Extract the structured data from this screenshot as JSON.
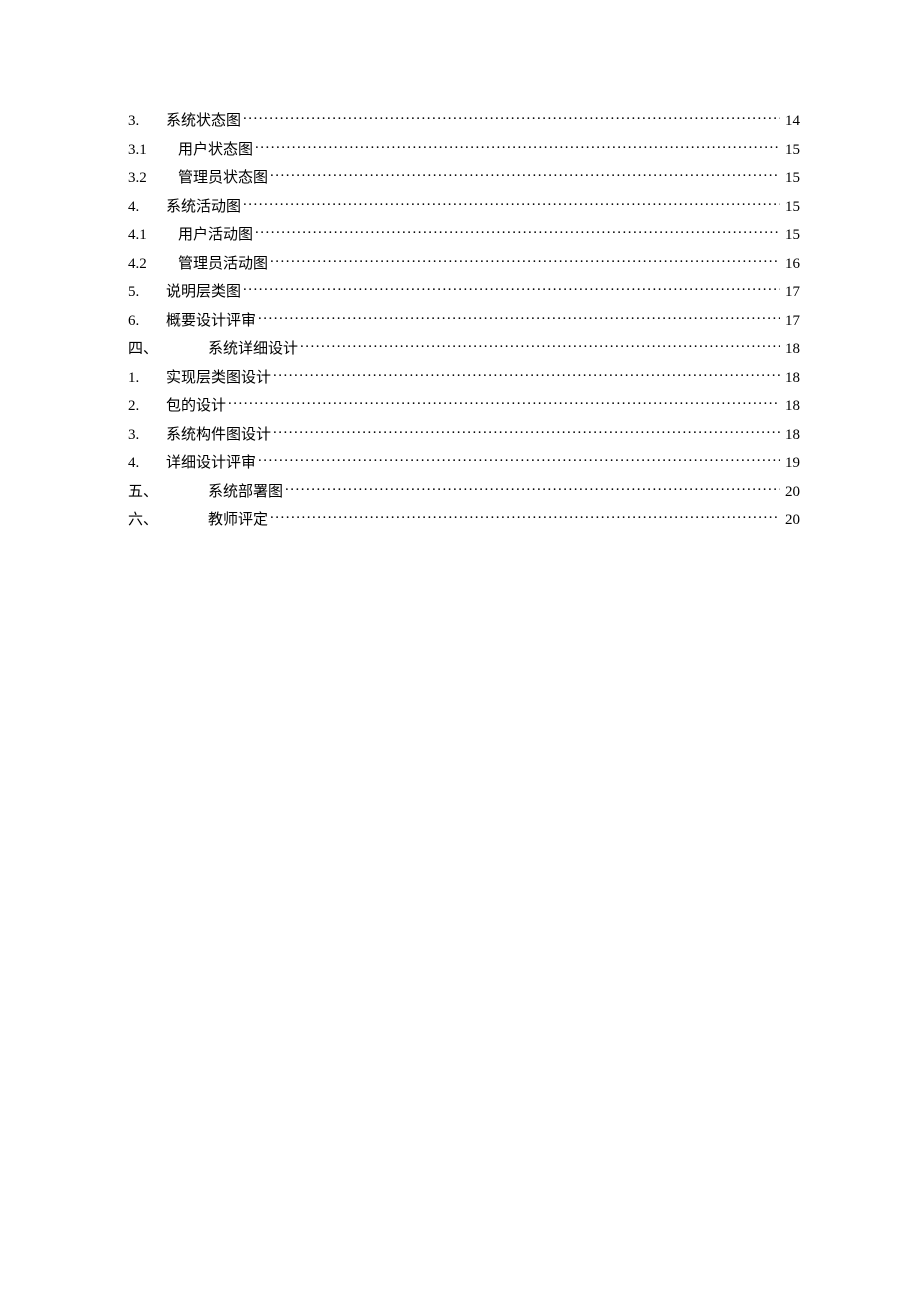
{
  "toc": [
    {
      "num": "3.",
      "title": "系统状态图",
      "page": "14",
      "indent": "none"
    },
    {
      "num": "3.1",
      "title": "用户状态图",
      "page": "15",
      "indent": "sub"
    },
    {
      "num": "3.2",
      "title": "管理员状态图",
      "page": "15",
      "indent": "sub"
    },
    {
      "num": "4.",
      "title": "系统活动图",
      "page": "15",
      "indent": "none"
    },
    {
      "num": "4.1",
      "title": "用户活动图",
      "page": "15",
      "indent": "sub"
    },
    {
      "num": "4.2",
      "title": "管理员活动图",
      "page": "16",
      "indent": "sub"
    },
    {
      "num": "5.",
      "title": "说明层类图",
      "page": "17",
      "indent": "none"
    },
    {
      "num": "6.",
      "title": "概要设计评审",
      "page": "17",
      "indent": "none"
    },
    {
      "num": "四、",
      "title": "系统详细设计",
      "page": "18",
      "indent": "chapter"
    },
    {
      "num": "1.",
      "title": "实现层类图设计",
      "page": "18",
      "indent": "none"
    },
    {
      "num": "2.",
      "title": "包的设计",
      "page": "18",
      "indent": "none"
    },
    {
      "num": "3.",
      "title": "系统构件图设计",
      "page": "18",
      "indent": "none"
    },
    {
      "num": "4.",
      "title": "详细设计评审",
      "page": "19",
      "indent": "none"
    },
    {
      "num": "五、",
      "title": "系统部署图",
      "page": "20",
      "indent": "chapter"
    },
    {
      "num": "六、",
      "title": "教师评定",
      "page": "20",
      "indent": "chapter"
    }
  ]
}
